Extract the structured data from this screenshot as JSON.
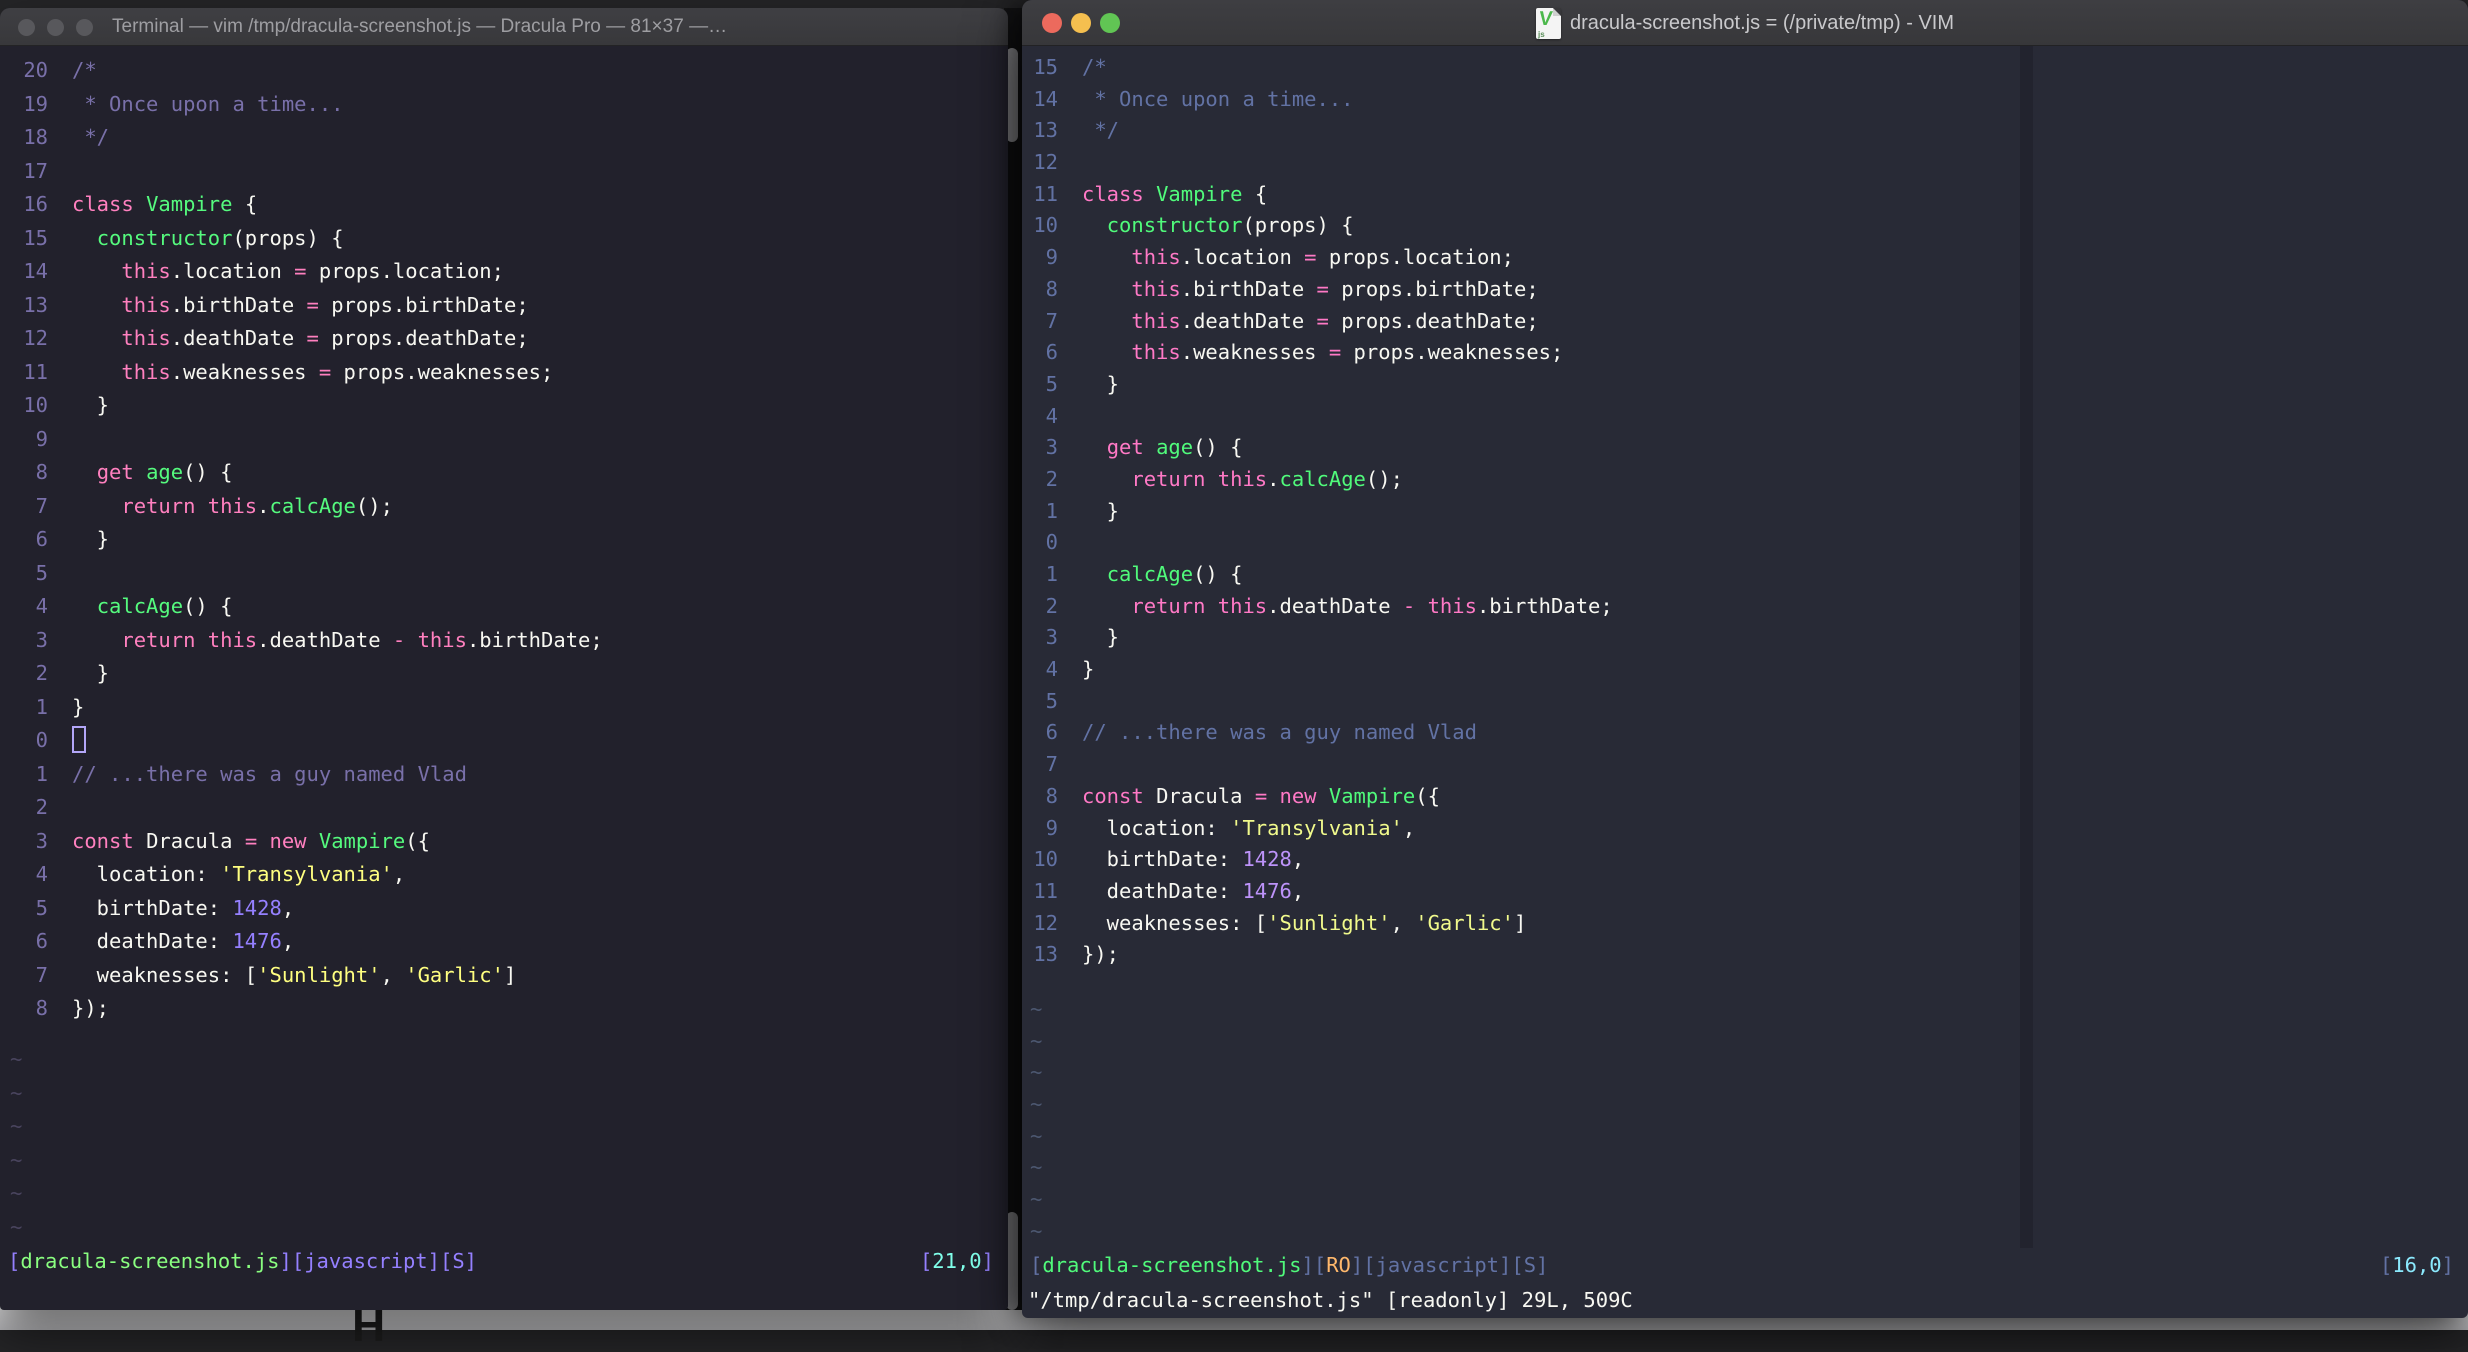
{
  "desktop": {
    "background_glyph": "H"
  },
  "left_window": {
    "titlebar": {
      "title": "Terminal — vim /tmp/dracula-screenshot.js — Dracula Pro — 81×37 —…"
    },
    "colors": {
      "background": "#22212C",
      "foreground": "#F8F8F2",
      "comment": "#7970A9",
      "pink": "#FF80BF",
      "green": "#55FA7E",
      "yellow": "#FFFF80",
      "purple": "#9580FF",
      "cyan": "#80FFEA",
      "titlebar": "#3a3a3e"
    },
    "tildes": {
      "count": 6,
      "char": "~"
    },
    "lines": [
      {
        "n": "20",
        "t": [
          [
            "c",
            "/*"
          ]
        ]
      },
      {
        "n": "19",
        "t": [
          [
            "c",
            " * Once upon a time..."
          ]
        ]
      },
      {
        "n": "18",
        "t": [
          [
            "c",
            " */"
          ]
        ]
      },
      {
        "n": "17",
        "t": []
      },
      {
        "n": "16",
        "t": [
          [
            "k",
            "class "
          ],
          [
            "f",
            "Vampire "
          ],
          [
            "t",
            "{"
          ]
        ]
      },
      {
        "n": "15",
        "t": [
          [
            "t",
            "  "
          ],
          [
            "f",
            "constructor"
          ],
          [
            "t",
            "(props) {"
          ]
        ]
      },
      {
        "n": "14",
        "t": [
          [
            "t",
            "    "
          ],
          [
            "k",
            "this"
          ],
          [
            "t",
            ".location "
          ],
          [
            "k",
            "="
          ],
          [
            "t",
            " props.location;"
          ]
        ]
      },
      {
        "n": "13",
        "t": [
          [
            "t",
            "    "
          ],
          [
            "k",
            "this"
          ],
          [
            "t",
            ".birthDate "
          ],
          [
            "k",
            "="
          ],
          [
            "t",
            " props.birthDate;"
          ]
        ]
      },
      {
        "n": "12",
        "t": [
          [
            "t",
            "    "
          ],
          [
            "k",
            "this"
          ],
          [
            "t",
            ".deathDate "
          ],
          [
            "k",
            "="
          ],
          [
            "t",
            " props.deathDate;"
          ]
        ]
      },
      {
        "n": "11",
        "t": [
          [
            "t",
            "    "
          ],
          [
            "k",
            "this"
          ],
          [
            "t",
            ".weaknesses "
          ],
          [
            "k",
            "="
          ],
          [
            "t",
            " props.weaknesses;"
          ]
        ]
      },
      {
        "n": "10",
        "t": [
          [
            "t",
            "  }"
          ]
        ]
      },
      {
        "n": "9",
        "t": []
      },
      {
        "n": "8",
        "t": [
          [
            "t",
            "  "
          ],
          [
            "k",
            "get "
          ],
          [
            "f",
            "age"
          ],
          [
            "t",
            "() {"
          ]
        ]
      },
      {
        "n": "7",
        "t": [
          [
            "t",
            "    "
          ],
          [
            "k",
            "return this"
          ],
          [
            "t",
            "."
          ],
          [
            "f",
            "calcAge"
          ],
          [
            "t",
            "();"
          ]
        ]
      },
      {
        "n": "6",
        "t": [
          [
            "t",
            "  }"
          ]
        ]
      },
      {
        "n": "5",
        "t": []
      },
      {
        "n": "4",
        "t": [
          [
            "t",
            "  "
          ],
          [
            "f",
            "calcAge"
          ],
          [
            "t",
            "() {"
          ]
        ]
      },
      {
        "n": "3",
        "t": [
          [
            "t",
            "    "
          ],
          [
            "k",
            "return this"
          ],
          [
            "t",
            ".deathDate "
          ],
          [
            "k",
            "-"
          ],
          [
            "t",
            " "
          ],
          [
            "k",
            "this"
          ],
          [
            "t",
            ".birthDate;"
          ]
        ]
      },
      {
        "n": "2",
        "t": [
          [
            "t",
            "  }"
          ]
        ]
      },
      {
        "n": "1",
        "t": [
          [
            "t",
            "}"
          ]
        ]
      },
      {
        "n": "0",
        "t": [
          [
            "cur",
            ""
          ]
        ]
      },
      {
        "n": "1",
        "t": [
          [
            "c",
            "// ...there was a guy named Vlad"
          ]
        ]
      },
      {
        "n": "2",
        "t": []
      },
      {
        "n": "3",
        "t": [
          [
            "k",
            "const "
          ],
          [
            "t",
            "Dracula "
          ],
          [
            "k",
            "= new "
          ],
          [
            "f",
            "Vampire"
          ],
          [
            "t",
            "({"
          ]
        ]
      },
      {
        "n": "4",
        "t": [
          [
            "t",
            "  location: "
          ],
          [
            "s",
            "'Transylvania'"
          ],
          [
            "t",
            ","
          ]
        ]
      },
      {
        "n": "5",
        "t": [
          [
            "t",
            "  birthDate: "
          ],
          [
            "d",
            "1428"
          ],
          [
            "t",
            ","
          ]
        ]
      },
      {
        "n": "6",
        "t": [
          [
            "t",
            "  deathDate: "
          ],
          [
            "d",
            "1476"
          ],
          [
            "t",
            ","
          ]
        ]
      },
      {
        "n": "7",
        "t": [
          [
            "t",
            "  weaknesses: ["
          ],
          [
            "s",
            "'Sunlight'"
          ],
          [
            "t",
            ", "
          ],
          [
            "s",
            "'Garlic'"
          ],
          [
            "t",
            "]"
          ]
        ]
      },
      {
        "n": "8",
        "t": [
          [
            "t",
            "});"
          ]
        ]
      }
    ],
    "status_left": [
      [
        "sb",
        "["
      ],
      [
        "sf",
        "dracula-screenshot.js"
      ],
      [
        "sb",
        "]["
      ],
      [
        "sj",
        "javascript"
      ],
      [
        "sb",
        "]["
      ],
      [
        "sj",
        "S"
      ],
      [
        "sb",
        "]"
      ]
    ],
    "status_right": [
      [
        "sb",
        "["
      ],
      [
        "sc",
        "21,0"
      ],
      [
        "sb",
        "]"
      ]
    ],
    "cmdline": ""
  },
  "right_window": {
    "titlebar": {
      "title": "dracula-screenshot.js = (/private/tmp) - VIM"
    },
    "colors": {
      "background": "#282A36",
      "foreground": "#F8F8F2",
      "comment": "#6272A4",
      "pink": "#FF79C6",
      "green": "#50FA7B",
      "yellow": "#F1FA8C",
      "purple": "#BD93F9",
      "cyan": "#8BE9FD",
      "orange": "#FFB86C",
      "titlebar": "#39393d",
      "traffic_red": "#EC6A5D",
      "traffic_yellow": "#F5BF4F",
      "traffic_green": "#61C554"
    },
    "doc_icon": {
      "letter": "V",
      "label": "js"
    },
    "tildes": {
      "count": 8,
      "char": "~"
    },
    "lines": [
      {
        "n": "15",
        "t": [
          [
            "c",
            "/*"
          ]
        ]
      },
      {
        "n": "14",
        "t": [
          [
            "c",
            " * Once upon a time..."
          ]
        ]
      },
      {
        "n": "13",
        "t": [
          [
            "c",
            " */"
          ]
        ]
      },
      {
        "n": "12",
        "t": []
      },
      {
        "n": "11",
        "t": [
          [
            "k",
            "class "
          ],
          [
            "f",
            "Vampire "
          ],
          [
            "t",
            "{"
          ]
        ]
      },
      {
        "n": "10",
        "t": [
          [
            "t",
            "  "
          ],
          [
            "f",
            "constructor"
          ],
          [
            "t",
            "(props) {"
          ]
        ]
      },
      {
        "n": "9",
        "t": [
          [
            "t",
            "    "
          ],
          [
            "k",
            "this"
          ],
          [
            "t",
            ".location "
          ],
          [
            "k",
            "="
          ],
          [
            "t",
            " props.location;"
          ]
        ]
      },
      {
        "n": "8",
        "t": [
          [
            "t",
            "    "
          ],
          [
            "k",
            "this"
          ],
          [
            "t",
            ".birthDate "
          ],
          [
            "k",
            "="
          ],
          [
            "t",
            " props.birthDate;"
          ]
        ]
      },
      {
        "n": "7",
        "t": [
          [
            "t",
            "    "
          ],
          [
            "k",
            "this"
          ],
          [
            "t",
            ".deathDate "
          ],
          [
            "k",
            "="
          ],
          [
            "t",
            " props.deathDate;"
          ]
        ]
      },
      {
        "n": "6",
        "t": [
          [
            "t",
            "    "
          ],
          [
            "k",
            "this"
          ],
          [
            "t",
            ".weaknesses "
          ],
          [
            "k",
            "="
          ],
          [
            "t",
            " props.weaknesses;"
          ]
        ]
      },
      {
        "n": "5",
        "t": [
          [
            "t",
            "  }"
          ]
        ]
      },
      {
        "n": "4",
        "t": []
      },
      {
        "n": "3",
        "t": [
          [
            "t",
            "  "
          ],
          [
            "k",
            "get "
          ],
          [
            "f",
            "age"
          ],
          [
            "t",
            "() {"
          ]
        ]
      },
      {
        "n": "2",
        "t": [
          [
            "t",
            "    "
          ],
          [
            "k",
            "return this"
          ],
          [
            "t",
            "."
          ],
          [
            "f",
            "calcAge"
          ],
          [
            "t",
            "();"
          ]
        ]
      },
      {
        "n": "1",
        "t": [
          [
            "t",
            "  }"
          ]
        ]
      },
      {
        "n": "0",
        "t": []
      },
      {
        "n": "1",
        "t": [
          [
            "t",
            "  "
          ],
          [
            "f",
            "calcAge"
          ],
          [
            "t",
            "() {"
          ]
        ]
      },
      {
        "n": "2",
        "t": [
          [
            "t",
            "    "
          ],
          [
            "k",
            "return this"
          ],
          [
            "t",
            ".deathDate "
          ],
          [
            "k",
            "-"
          ],
          [
            "t",
            " "
          ],
          [
            "k",
            "this"
          ],
          [
            "t",
            ".birthDate;"
          ]
        ]
      },
      {
        "n": "3",
        "t": [
          [
            "t",
            "  }"
          ]
        ]
      },
      {
        "n": "4",
        "t": [
          [
            "t",
            "}"
          ]
        ]
      },
      {
        "n": "5",
        "t": []
      },
      {
        "n": "6",
        "t": [
          [
            "c",
            "// ...there was a guy named Vlad"
          ]
        ]
      },
      {
        "n": "7",
        "t": []
      },
      {
        "n": "8",
        "t": [
          [
            "k",
            "const "
          ],
          [
            "t",
            "Dracula "
          ],
          [
            "k",
            "= new "
          ],
          [
            "f",
            "Vampire"
          ],
          [
            "t",
            "({"
          ]
        ]
      },
      {
        "n": "9",
        "t": [
          [
            "t",
            "  location: "
          ],
          [
            "s",
            "'Transylvania'"
          ],
          [
            "t",
            ","
          ]
        ]
      },
      {
        "n": "10",
        "t": [
          [
            "t",
            "  birthDate: "
          ],
          [
            "d",
            "1428"
          ],
          [
            "t",
            ","
          ]
        ]
      },
      {
        "n": "11",
        "t": [
          [
            "t",
            "  deathDate: "
          ],
          [
            "d",
            "1476"
          ],
          [
            "t",
            ","
          ]
        ]
      },
      {
        "n": "12",
        "t": [
          [
            "t",
            "  weaknesses: ["
          ],
          [
            "s",
            "'Sunlight'"
          ],
          [
            "t",
            ", "
          ],
          [
            "s",
            "'Garlic'"
          ],
          [
            "t",
            "]"
          ]
        ]
      },
      {
        "n": "13",
        "t": [
          [
            "t",
            "});"
          ]
        ]
      }
    ],
    "status_left": [
      [
        "sb",
        "["
      ],
      [
        "sf",
        "dracula-screenshot.js"
      ],
      [
        "sb",
        "]["
      ],
      [
        "ro",
        "RO"
      ],
      [
        "sb",
        "]["
      ],
      [
        "sj",
        "javascript"
      ],
      [
        "sb",
        "]["
      ],
      [
        "sj",
        "S"
      ],
      [
        "sb",
        "]"
      ]
    ],
    "status_right": [
      [
        "sb",
        "["
      ],
      [
        "sc",
        "16,0"
      ],
      [
        "sb",
        "]"
      ]
    ],
    "cmdline": "\"/tmp/dracula-screenshot.js\" [readonly] 29L, 509C"
  }
}
